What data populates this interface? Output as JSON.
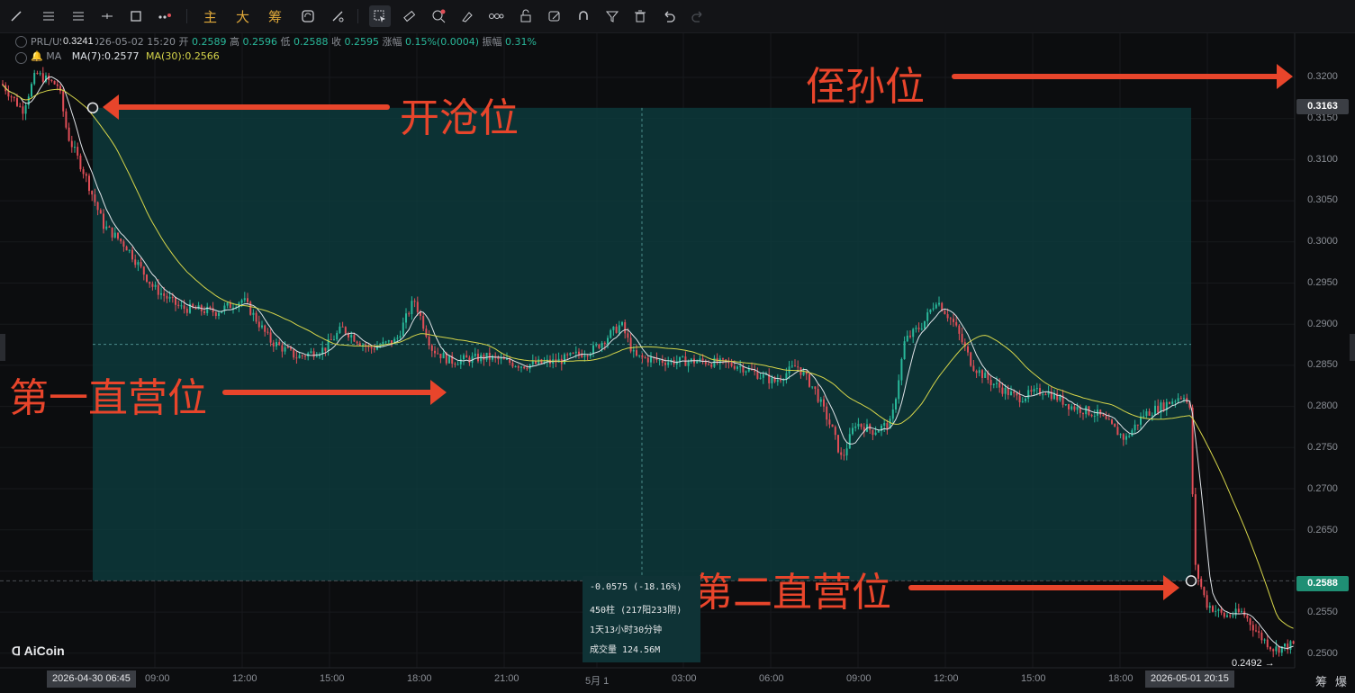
{
  "toolbar": {
    "drawing_tools": [
      "line-icon",
      "horizontal-lines-icon",
      "parallel-lines-icon",
      "ray-icon",
      "rectangle-icon",
      "more-dots-icon"
    ],
    "quick_labels": [
      "主",
      "大",
      "筹"
    ],
    "tools": [
      "sync-icon",
      "measure-icon",
      "select-icon",
      "ruler-icon",
      "zoom-plus-icon",
      "brush-icon",
      "chain-icon",
      "lock-icon",
      "edit-icon",
      "magnet-icon",
      "filter-icon",
      "trash-icon",
      "undo-icon",
      "redo-icon"
    ],
    "accent": "#e0a93a"
  },
  "legend": {
    "symbol": "PRL/USDT",
    "datetime": "2026-05-02 15:20",
    "open_label": "开",
    "open": "0.2589",
    "high_label": "高",
    "high": "0.2596",
    "low_label": "低",
    "low": "0.2588",
    "close_label": "收",
    "close": "0.2595",
    "change_label": "涨幅",
    "change": "0.15%(0.0004)",
    "amp_label": "振幅",
    "amp": "0.31%",
    "ma_title": "MA",
    "ma7": "MA(7):0.2577",
    "ma30": "MA(30):0.2566",
    "hover_price": "0.3241"
  },
  "annotations": {
    "stop_loss": "侄孙位",
    "entry": "开沧位",
    "tp1": "第一直营位",
    "tp2": "第二直营位"
  },
  "price_axis": {
    "labels": [
      "0.3200",
      "0.3150",
      "0.3100",
      "0.3050",
      "0.3000",
      "0.2950",
      "0.2900",
      "0.2850",
      "0.2800",
      "0.2750",
      "0.2700",
      "0.2650",
      "0.2550",
      "0.2500"
    ],
    "entry_tag": "0.3163",
    "current_tag": "0.2588",
    "low_marker": "0.2492 →"
  },
  "time_axis": {
    "labels": [
      "09:00",
      "12:00",
      "15:00",
      "18:00",
      "21:00",
      "5月 1",
      "03:00",
      "06:00",
      "09:00",
      "12:00",
      "15:00",
      "18:00"
    ],
    "start_tag": "2026-04-30 06:45",
    "end_tag": "2026-05-01 20:15"
  },
  "measure_box": {
    "change": "-0.0575 (-18.16%)",
    "bars": "450柱 (217阳233阴)",
    "duration": "1天13小时30分钟",
    "volume": "成交量 124.56M"
  },
  "branding": {
    "logo": "AiCoin"
  },
  "bottom_buttons": [
    "筹",
    "爆"
  ],
  "colors": {
    "up": "#29b89a",
    "down": "#e04e57",
    "ma7": "#dfe3e8",
    "ma30": "#d6d54a",
    "measure_fill": "#0d3a3b",
    "annotation": "#e8452b",
    "entry_tag_bg": "#3b3e44",
    "current_tag_bg": "#1f8f74"
  }
}
